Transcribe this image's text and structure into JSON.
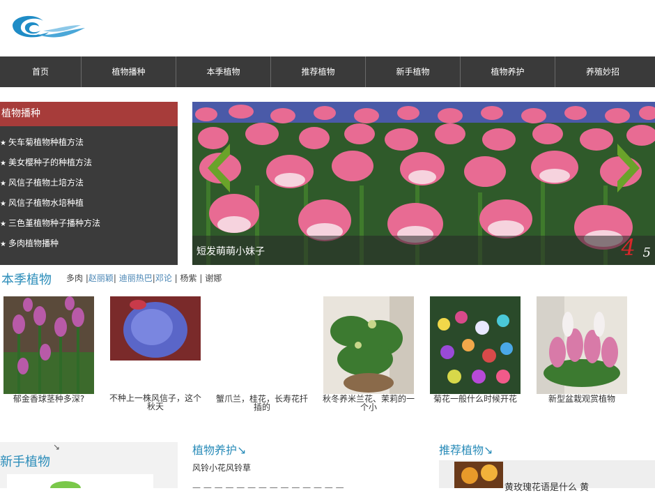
{
  "nav": {
    "items": [
      "首页",
      "植物播种",
      "本季植物",
      "推荐植物",
      "新手植物",
      "植物养护",
      "养殖妙招"
    ]
  },
  "sidebar": {
    "title": "植物播种",
    "items": [
      "矢车菊植物种植方法",
      "美女樱种子的种植方法",
      "风信子植物土培方法",
      "风信子植物水培种植",
      "三色堇植物种子播种方法",
      "多肉植物播种"
    ]
  },
  "slider": {
    "caption": "短发萌萌小妹子",
    "current": "4",
    "total": "5"
  },
  "season": {
    "title": "本季植物",
    "tags": [
      "多肉",
      "赵丽颖",
      "迪丽热巴",
      "邓论",
      "杨紫",
      "谢娜"
    ],
    "cards": [
      "郁金香球茎种多深?",
      "不种上一株风信子，这个秋天",
      "蟹爪兰，桂花，长寿花扦插的",
      "秋冬养米兰花、茉莉的一个小",
      "菊花一般什么时候开花",
      "新型盆栽观赏植物"
    ]
  },
  "newbie": {
    "title": "新手植物"
  },
  "care": {
    "title": "植物养护",
    "items": [
      "风铃小花风铃草"
    ]
  },
  "recommend": {
    "title": "推荐植物",
    "item": "黄玫瑰花语是什么 黄"
  },
  "colors": {
    "nav_bg": "#3a3a3a",
    "sidebar_bg": "#3b3b3b",
    "sidebar_head": "#a73c3a",
    "accent_blue": "#2a8cb9",
    "arrow_green": "#6aa32a",
    "slide_num_red": "#d8262a"
  }
}
